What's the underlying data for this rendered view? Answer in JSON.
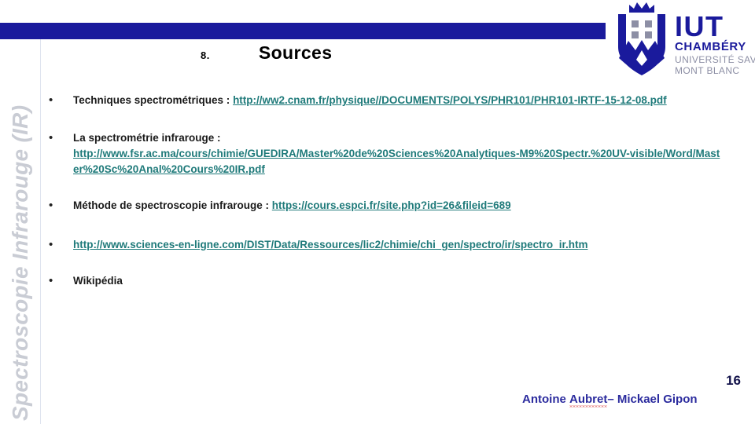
{
  "slide": {
    "sidebar_title": "Spectroscopie Infrarouge (IR)",
    "title_number": "8.",
    "title_label": "Sources",
    "bullet_glyph": "•",
    "page_number": "16",
    "authors_prefix": "Antoine ",
    "authors_misspelled": "Aubret",
    "authors_suffix": "– Mickael Gipon",
    "accent_bar_color": "#1a1a9c",
    "link_color": "#1f7a7a",
    "sidebar_text_color": "#c9ccd4",
    "footer_text_color": "#2b2b9e"
  },
  "bullets": [
    {
      "text": "Techniques spectrométriques : ",
      "link": "http://ww2.cnam.fr/physique//DOCUMENTS/POLYS/PHR101/PHR101-IRTF-15-12-08.pdf"
    },
    {
      "text": "La spectrométrie infrarouge :",
      "link": "http://www.fsr.ac.ma/cours/chimie/GUEDIRA/Master%20de%20Sciences%20Analytiques-M9%20Spectr.%20UV-visible/Word/Master%20Sc%20Anal%20Cours%20IR.pdf"
    },
    {
      "text": "Méthode de spectroscopie infrarouge : ",
      "link": "https://cours.espci.fr/site.php?id=26&fileid=689"
    },
    {
      "text": "",
      "link": "http://www.sciences-en-ligne.com/DIST/Data/Ressources/lic2/chimie/chi_gen/spectro/ir/spectro_ir.htm"
    },
    {
      "text": "Wikipédia",
      "link": ""
    }
  ],
  "logo": {
    "name": "IUT Chambéry Université Savoie Mont Blanc",
    "line1": "IUT",
    "line2": "CHAMBÉRY",
    "line3": "UNIVERSITÉ SAVOIE",
    "line4": "MONT BLANC",
    "primary_color": "#1a1a9c",
    "secondary_color": "#8d8fa5"
  }
}
